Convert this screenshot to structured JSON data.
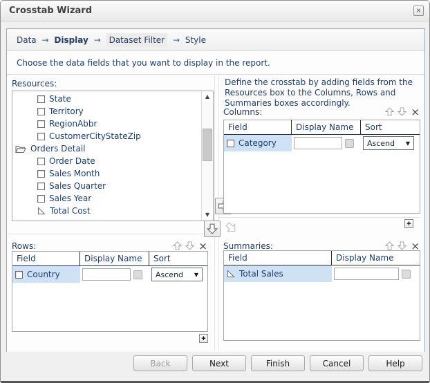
{
  "window": {
    "title": "Crosstab Wizard"
  },
  "icons": {
    "close": "×",
    "remove": "×",
    "plus": "+",
    "sort_caret": "▼",
    "scroll_up": "▲",
    "scroll_down": "▼"
  },
  "breadcrumb": {
    "separator": "→",
    "items": [
      {
        "label": "Data"
      },
      {
        "label": "Display"
      },
      {
        "label": "Dataset Filter"
      },
      {
        "label": "Style"
      }
    ]
  },
  "instruction": "Choose the data fields that you want to display in the report.",
  "resources": {
    "label": "Resources:",
    "items": [
      {
        "name": "State",
        "icon": "column"
      },
      {
        "name": "Territory",
        "icon": "column"
      },
      {
        "name": "RegionAbbr",
        "icon": "column"
      },
      {
        "name": "CustomerCityStateZip",
        "icon": "column"
      },
      {
        "name": "Orders Detail",
        "icon": "folder-open"
      },
      {
        "name": "Order Date",
        "icon": "column"
      },
      {
        "name": "Sales Month",
        "icon": "column"
      },
      {
        "name": "Sales Quarter",
        "icon": "column"
      },
      {
        "name": "Sales Year",
        "icon": "column"
      },
      {
        "name": "Total Cost",
        "icon": "summary"
      }
    ]
  },
  "define_text": "Define the crosstab by adding fields from the Resources box to the Columns, Rows and Summaries boxes accordingly.",
  "columns_panel": {
    "label": "Columns:",
    "headers": [
      "Field",
      "Display Name",
      "Sort"
    ],
    "rows": [
      {
        "field": "Category",
        "icon": "column",
        "display_name": "",
        "sort": "Ascend"
      }
    ]
  },
  "rows_panel": {
    "label": "Rows:",
    "headers": [
      "Field",
      "Display Name",
      "Sort"
    ],
    "rows": [
      {
        "field": "Country",
        "icon": "column",
        "display_name": "",
        "sort": "Ascend"
      }
    ]
  },
  "summaries_panel": {
    "label": "Summaries:",
    "headers": [
      "Field",
      "Display Name"
    ],
    "rows": [
      {
        "field": "Total Sales",
        "icon": "summary",
        "display_name": ""
      }
    ]
  },
  "footer": {
    "buttons": [
      {
        "label": "Back",
        "disabled": true
      },
      {
        "label": "Next",
        "disabled": false
      },
      {
        "label": "Finish",
        "disabled": false
      },
      {
        "label": "Cancel",
        "disabled": false
      },
      {
        "label": "Help",
        "disabled": false
      }
    ]
  },
  "colors": {
    "accent_text": "#1f3d6b",
    "selection": "#cfe1f4",
    "header_line": "#1b2f4b",
    "panel_border": "#97a9bd"
  }
}
